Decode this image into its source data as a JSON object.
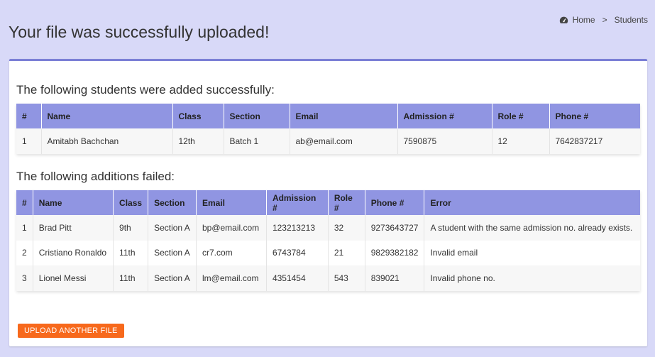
{
  "page_title": "Your file was successfully uploaded!",
  "breadcrumb": {
    "home": "Home",
    "separator": ">",
    "current": "Students",
    "icon": "dashboard-icon"
  },
  "success": {
    "heading": "The following students were added successfully:",
    "columns": [
      "#",
      "Name",
      "Class",
      "Section",
      "Email",
      "Admission #",
      "Role #",
      "Phone #"
    ],
    "rows": [
      [
        "1",
        "Amitabh Bachchan",
        "12th",
        "Batch 1",
        "ab@email.com",
        "7590875",
        "12",
        "7642837217"
      ]
    ]
  },
  "failed": {
    "heading": "The following additions failed:",
    "columns": [
      "#",
      "Name",
      "Class",
      "Section",
      "Email",
      "Admission #",
      "Role #",
      "Phone #",
      "Error"
    ],
    "rows": [
      [
        "1",
        "Brad Pitt",
        "9th",
        "Section A",
        "bp@email.com",
        "123213213",
        "32",
        "9273643727",
        "A student with the same admission no. already exists."
      ],
      [
        "2",
        "Cristiano Ronaldo",
        "11th",
        "Section A",
        "cr7.com",
        "6743784",
        "21",
        "9829382182",
        "Invalid email"
      ],
      [
        "3",
        "Lionel Messi",
        "11th",
        "Section A",
        "lm@email.com",
        "4351454",
        "543",
        "839021",
        "Invalid phone no."
      ]
    ]
  },
  "upload_button_label": "UPLOAD ANOTHER FILE",
  "colors": {
    "background": "#d8d9f8",
    "header_accent": "#7b7fd6",
    "table_header": "#9095e2",
    "button": "#f7691c"
  }
}
